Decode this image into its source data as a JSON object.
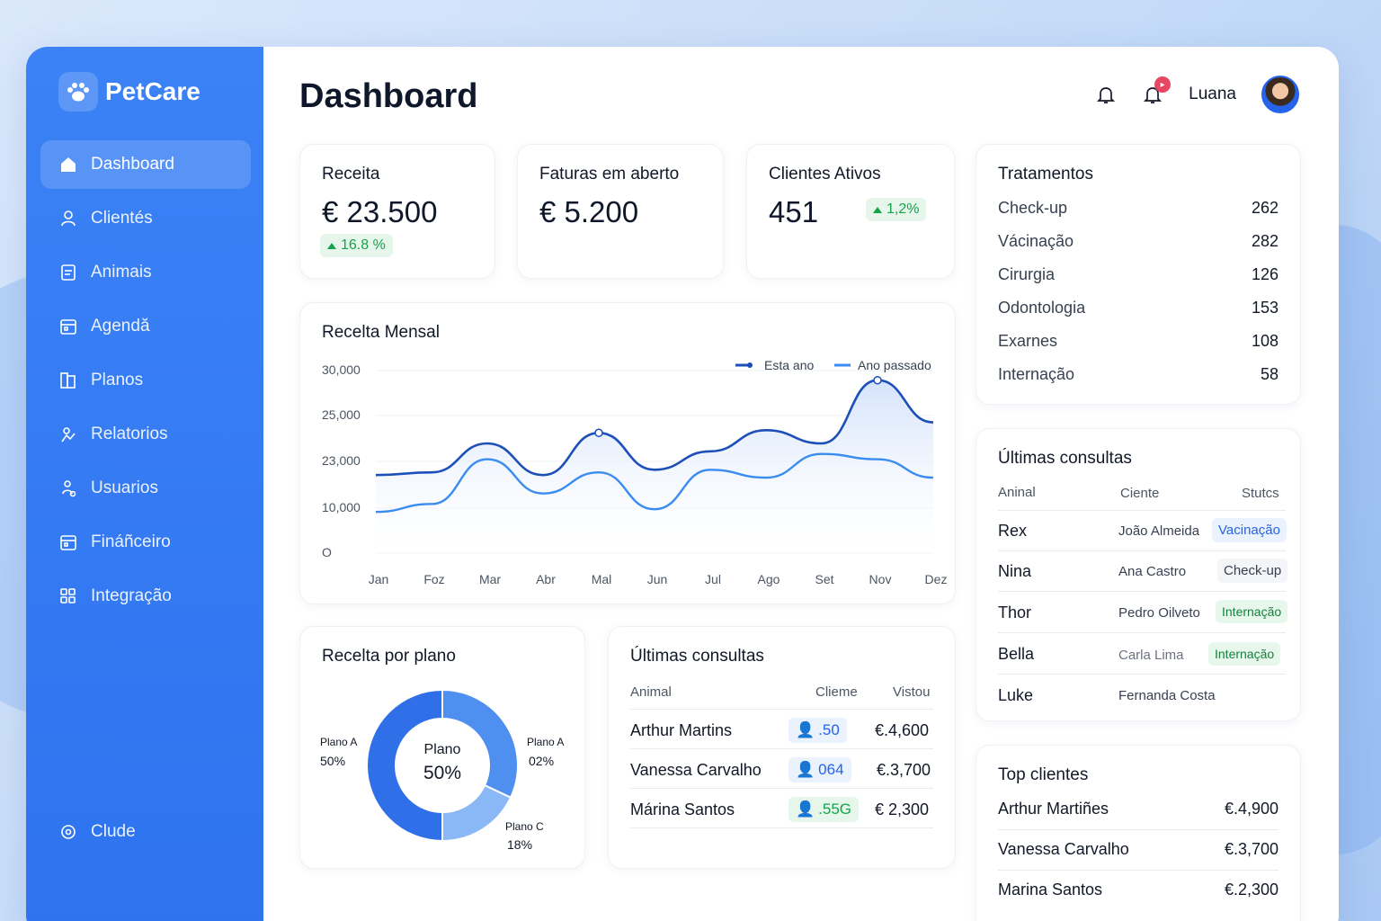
{
  "app": {
    "name": "PetCare"
  },
  "sidebar": {
    "items": [
      {
        "label": "Dashboard",
        "icon": "home-icon"
      },
      {
        "label": "Clientés",
        "icon": "user-icon"
      },
      {
        "label": "Animais",
        "icon": "clipboard-icon"
      },
      {
        "label": "Agendă",
        "icon": "calendar-icon"
      },
      {
        "label": "Planos",
        "icon": "book-icon"
      },
      {
        "label": "Relatorios",
        "icon": "chart-icon"
      },
      {
        "label": "Usuarios",
        "icon": "users-icon"
      },
      {
        "label": "Fináñceiro",
        "icon": "wallet-icon"
      },
      {
        "label": "Integração",
        "icon": "grid-icon"
      }
    ],
    "bottom": {
      "label": "Clude",
      "icon": "settings-icon"
    }
  },
  "header": {
    "title": "Dashboard",
    "user": "Luana"
  },
  "kpis": {
    "receita": {
      "label": "Receita",
      "value": "€ 23.500",
      "delta": "16.8 %"
    },
    "faturas": {
      "label": "Faturas em aberto",
      "value": "€ 5.200"
    },
    "clientes": {
      "label": "Clientes Ativos",
      "value": "451",
      "delta": "1,2%"
    }
  },
  "treatments": {
    "title": "Tratamentos",
    "items": [
      {
        "name": "Check-up",
        "count": "262"
      },
      {
        "name": "Vácinação",
        "count": "282"
      },
      {
        "name": "Cirurgia",
        "count": "126"
      },
      {
        "name": "Odontologia",
        "count": "153"
      },
      {
        "name": "Exarnes",
        "count": "108"
      },
      {
        "name": "Internação",
        "count": "58"
      }
    ]
  },
  "revenue_chart": {
    "title": "Recelta Mensal",
    "legend": [
      "Esta ano",
      "Ano passado"
    ],
    "y_ticks": [
      "30,000",
      "25,000",
      "23,000",
      "10,000",
      "O"
    ],
    "colors": {
      "this_year": "#1d4fb8",
      "last_year": "#3b8cf0"
    }
  },
  "chart_data": {
    "type": "line",
    "title": "Recelta Mensal",
    "categories": [
      "Jan",
      "Foz",
      "Mar",
      "Abr",
      "Mal",
      "Jun",
      "Jul",
      "Ago",
      "Set",
      "Nov",
      "Dez"
    ],
    "series": [
      {
        "name": "Esta ano",
        "values": [
          15000,
          15500,
          21000,
          15000,
          23000,
          16000,
          19500,
          23500,
          21000,
          33000,
          25000
        ]
      },
      {
        "name": "Ano passado",
        "values": [
          8000,
          9500,
          18000,
          11500,
          15500,
          8500,
          16000,
          14500,
          19000,
          18000,
          14500
        ]
      }
    ],
    "y_tick_labels": [
      "30,000",
      "25,000",
      "23,000",
      "10,000",
      "O"
    ],
    "grid": true,
    "legend_position": "top-right"
  },
  "plan_chart": {
    "title": "Recelta por plano",
    "center_label": "Plano",
    "center_value": "50%",
    "slices": [
      {
        "name": "Plano A",
        "pct": "50%",
        "value": 50,
        "color": "#2f6fe8"
      },
      {
        "name": "Plano A",
        "pct": "02%",
        "value": 32,
        "color": "#4f8ff0"
      },
      {
        "name": "Plano C",
        "pct": "18%",
        "value": 18,
        "color": "#8ab8f7"
      }
    ]
  },
  "consults_mid": {
    "title": "Últimas consultas",
    "headers": [
      "Animal",
      "Clieme",
      "Vistou"
    ],
    "rows": [
      {
        "animal": "Arthur Martins",
        "client": ".50",
        "value": "€.4,600",
        "chip": "blue"
      },
      {
        "animal": "Vanessa Carvalho",
        "client": "064",
        "value": "€.3,700",
        "chip": "blue"
      },
      {
        "animal": "Márina Santos",
        "client": ".55G",
        "value": "€ 2,300",
        "chip": "green"
      }
    ]
  },
  "consults_right": {
    "title": "Últimas consultas",
    "headers": [
      "Aninal",
      "Ciente",
      "Stutcs"
    ],
    "rows": [
      {
        "animal": "Rex",
        "client": "João Almeida",
        "status": "Vacinação",
        "style": "blue"
      },
      {
        "animal": "Nina",
        "client": "Ana Castro",
        "status": "Check-up",
        "style": "gray"
      },
      {
        "animal": "Thor",
        "client": "Pedro Oilveto",
        "status": "Internação",
        "style": "green"
      },
      {
        "animal": "Bella",
        "client": "Carla Lima",
        "status": "Internação",
        "style": "green"
      },
      {
        "animal": "Luke",
        "client": "Fernanda Costa",
        "status": "",
        "style": ""
      }
    ]
  },
  "top_clients": {
    "title": "Top clientes",
    "rows": [
      {
        "name": "Arthur Martiñes",
        "value": "€.4,900"
      },
      {
        "name": "Vanessa Carvalho",
        "value": "€.3,700"
      },
      {
        "name": "Marina Santos",
        "value": "€.2,300"
      }
    ]
  }
}
